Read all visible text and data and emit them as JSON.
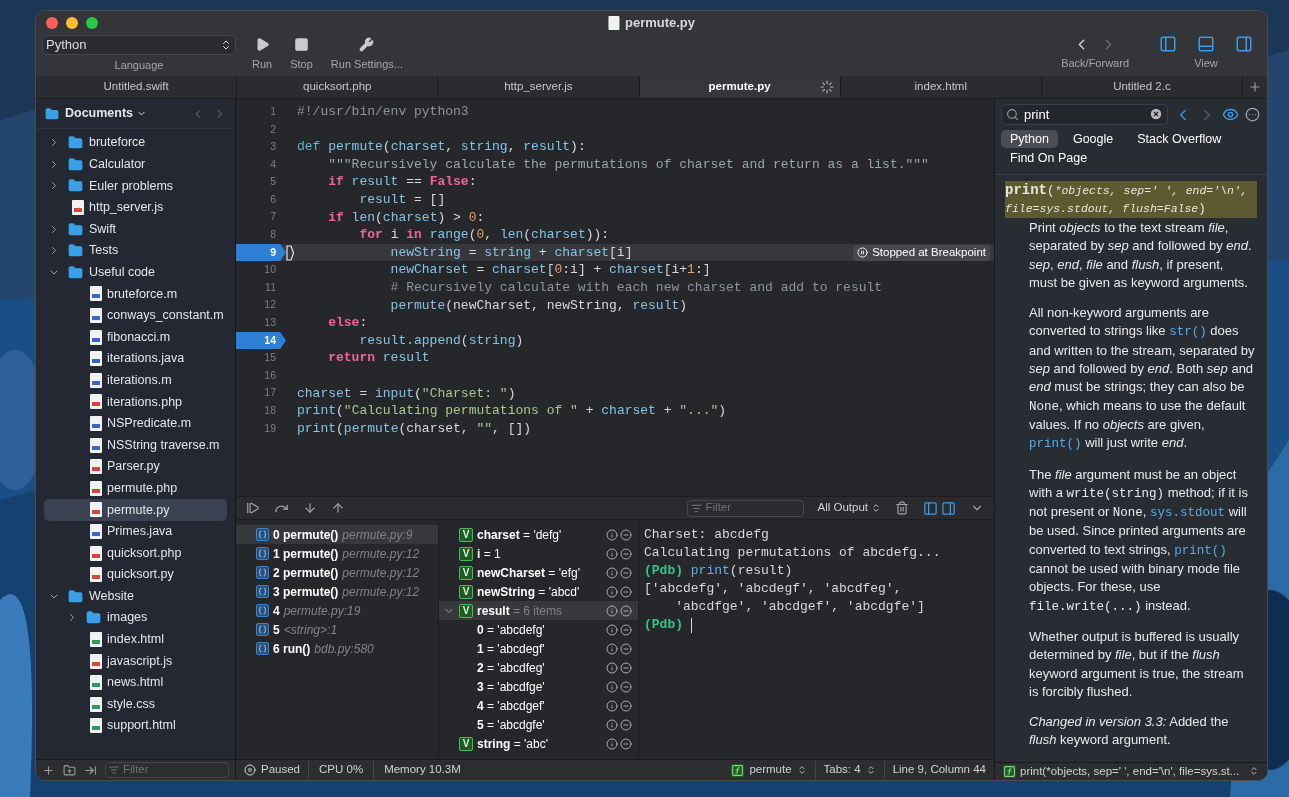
{
  "window": {
    "title": "permute.py"
  },
  "toolbar": {
    "language": {
      "value": "Python",
      "label": "Language"
    },
    "actions": [
      {
        "label": "Run",
        "kind": "run"
      },
      {
        "label": "Stop",
        "kind": "stop"
      },
      {
        "label": "Run Settings...",
        "kind": "settings"
      }
    ],
    "navigation": {
      "label": "Back/Forward",
      "back_enabled": true,
      "forward_enabled": false
    },
    "view": {
      "label": "View",
      "panels": [
        {
          "kind": "left",
          "on": true
        },
        {
          "kind": "bottom",
          "on": true
        },
        {
          "kind": "right",
          "on": true
        }
      ]
    }
  },
  "tabs": [
    {
      "label": "Untitled.swift",
      "selected": false,
      "busy": false
    },
    {
      "label": "quicksort.php",
      "selected": false,
      "busy": false
    },
    {
      "label": "http_server.js",
      "selected": false,
      "busy": false
    },
    {
      "label": "permute.py",
      "selected": true,
      "busy": true
    },
    {
      "label": "index.html",
      "selected": false,
      "busy": false
    },
    {
      "label": "Untitled 2.c",
      "selected": false,
      "busy": false
    }
  ],
  "sidebar": {
    "title": "Documents",
    "filter": {
      "placeholder": "Filter"
    },
    "items": [
      {
        "name": "bruteforce",
        "kind": "folder",
        "expanded": false,
        "selected": false
      },
      {
        "name": "Calculator",
        "kind": "folder",
        "expanded": false,
        "selected": false
      },
      {
        "name": "Euler problems",
        "kind": "folder",
        "expanded": false,
        "selected": false
      },
      {
        "name": "http_server.js",
        "kind": "file",
        "color": "#d9443f",
        "selected": false
      },
      {
        "name": "Swift",
        "kind": "folder",
        "expanded": false,
        "selected": false
      },
      {
        "name": "Tests",
        "kind": "folder",
        "expanded": false,
        "selected": false
      },
      {
        "name": "Useful code",
        "kind": "folder",
        "expanded": true,
        "selected": false,
        "children": [
          {
            "name": "bruteforce.m",
            "kind": "file",
            "color": "#3a64c8",
            "selected": false
          },
          {
            "name": "conways_constant.m",
            "kind": "file",
            "color": "#3a64c8",
            "selected": false
          },
          {
            "name": "fibonacci.m",
            "kind": "file",
            "color": "#3a64c8",
            "selected": false
          },
          {
            "name": "iterations.java",
            "kind": "file",
            "color": "#3a64c8",
            "selected": false
          },
          {
            "name": "iterations.m",
            "kind": "file",
            "color": "#3a64c8",
            "selected": false
          },
          {
            "name": "iterations.php",
            "kind": "file",
            "color": "#d9443f",
            "selected": false
          },
          {
            "name": "NSPredicate.m",
            "kind": "file",
            "color": "#3a64c8",
            "selected": false
          },
          {
            "name": "NSString traverse.m",
            "kind": "file",
            "color": "#3a64c8",
            "selected": false
          },
          {
            "name": "Parser.py",
            "kind": "file",
            "color": "#d9443f",
            "selected": false
          },
          {
            "name": "permute.php",
            "kind": "file",
            "color": "#d9443f",
            "selected": false
          },
          {
            "name": "permute.py",
            "kind": "file",
            "color": "#d9443f",
            "selected": true
          },
          {
            "name": "Primes.java",
            "kind": "file",
            "color": "#3a64c8",
            "selected": false
          },
          {
            "name": "quicksort.php",
            "kind": "file",
            "color": "#d9443f",
            "selected": false
          },
          {
            "name": "quicksort.py",
            "kind": "file",
            "color": "#d9443f",
            "selected": false
          }
        ]
      },
      {
        "name": "Website",
        "kind": "folder",
        "expanded": true,
        "selected": false,
        "children": [
          {
            "name": "images",
            "kind": "folder",
            "expanded": false,
            "selected": false
          },
          {
            "name": "index.html",
            "kind": "file",
            "color": "#2e9a5a",
            "selected": false
          },
          {
            "name": "javascript.js",
            "kind": "file",
            "color": "#d9443f",
            "selected": false
          },
          {
            "name": "news.html",
            "kind": "file",
            "color": "#2e9a5a",
            "selected": false
          },
          {
            "name": "style.css",
            "kind": "file",
            "color": "#2e9a5a",
            "selected": false
          },
          {
            "name": "support.html",
            "kind": "file",
            "color": "#2e9a5a",
            "selected": false
          }
        ]
      }
    ]
  },
  "editor": {
    "lines": [
      {
        "number": "1",
        "breakpoint": false,
        "current": false,
        "tokens": [
          {
            "text": "#!/usr/bin/env python3",
            "kind": "comment"
          }
        ]
      },
      {
        "number": "2",
        "breakpoint": false,
        "current": false
      },
      {
        "number": "3",
        "breakpoint": false,
        "current": false,
        "tokens": [
          {
            "text": "def",
            "kind": "def"
          },
          {
            "text": " permute",
            "kind": "name"
          },
          {
            "text": "(",
            "kind": "plain"
          },
          {
            "text": "charset",
            "kind": "name"
          },
          {
            "text": ", ",
            "kind": "plain"
          },
          {
            "text": "string",
            "kind": "name"
          },
          {
            "text": ", ",
            "kind": "plain"
          },
          {
            "text": "result",
            "kind": "name"
          },
          {
            "text": "):",
            "kind": "plain"
          }
        ]
      },
      {
        "number": "4",
        "breakpoint": false,
        "current": false,
        "tokens": [
          {
            "text": "    \"\"\"Recursively calculate the permutations of charset and return as a list.\"\"\"",
            "kind": "doc"
          }
        ]
      },
      {
        "number": "5",
        "breakpoint": false,
        "current": false,
        "tokens": [
          {
            "text": "    if",
            "kind": "kw"
          },
          {
            "text": " result",
            "kind": "name"
          },
          {
            "text": " == ",
            "kind": "plain"
          },
          {
            "text": "False",
            "kind": "kw"
          },
          {
            "text": ":",
            "kind": "plain"
          }
        ]
      },
      {
        "number": "6",
        "breakpoint": false,
        "current": false,
        "tokens": [
          {
            "text": "        result",
            "kind": "name"
          },
          {
            "text": " = []",
            "kind": "plain"
          }
        ]
      },
      {
        "number": "7",
        "breakpoint": false,
        "current": false,
        "tokens": [
          {
            "text": "    if",
            "kind": "kw"
          },
          {
            "text": " len",
            "kind": "name"
          },
          {
            "text": "(",
            "kind": "plain"
          },
          {
            "text": "charset",
            "kind": "name"
          },
          {
            "text": ") > ",
            "kind": "plain"
          },
          {
            "text": "0",
            "kind": "num"
          },
          {
            "text": ":",
            "kind": "plain"
          }
        ]
      },
      {
        "number": "8",
        "breakpoint": false,
        "current": false,
        "tokens": [
          {
            "text": "        for",
            "kind": "kw"
          },
          {
            "text": " i ",
            "kind": "plain"
          },
          {
            "text": "in",
            "kind": "kw"
          },
          {
            "text": " range",
            "kind": "name"
          },
          {
            "text": "(",
            "kind": "plain"
          },
          {
            "text": "0",
            "kind": "num"
          },
          {
            "text": ", ",
            "kind": "plain"
          },
          {
            "text": "len",
            "kind": "name"
          },
          {
            "text": "(",
            "kind": "plain"
          },
          {
            "text": "charset",
            "kind": "name"
          },
          {
            "text": ")):",
            "kind": "plain"
          }
        ]
      },
      {
        "number": "9",
        "breakpoint": true,
        "current": true,
        "badge": "Stopped at Breakpoint",
        "tokens": [
          {
            "text": "            newString",
            "kind": "name"
          },
          {
            "text": " = ",
            "kind": "plain"
          },
          {
            "text": "string",
            "kind": "name"
          },
          {
            "text": " + ",
            "kind": "plain"
          },
          {
            "text": "charset",
            "kind": "name"
          },
          {
            "text": "[i]",
            "kind": "plain"
          }
        ]
      },
      {
        "number": "10",
        "breakpoint": false,
        "current": false,
        "tokens": [
          {
            "text": "            newCharset",
            "kind": "name"
          },
          {
            "text": " = ",
            "kind": "plain"
          },
          {
            "text": "charset",
            "kind": "name"
          },
          {
            "text": "[",
            "kind": "plain"
          },
          {
            "text": "0",
            "kind": "num"
          },
          {
            "text": ":i] + ",
            "kind": "plain"
          },
          {
            "text": "charset",
            "kind": "name"
          },
          {
            "text": "[i+",
            "kind": "plain"
          },
          {
            "text": "1",
            "kind": "num"
          },
          {
            "text": ":]",
            "kind": "plain"
          }
        ]
      },
      {
        "number": "11",
        "breakpoint": false,
        "current": false,
        "tokens": [
          {
            "text": "            # Recursively calculate with each new charset and add to result",
            "kind": "comment"
          }
        ]
      },
      {
        "number": "12",
        "breakpoint": false,
        "current": false,
        "tokens": [
          {
            "text": "            permute",
            "kind": "name"
          },
          {
            "text": "(newCharset, newString, ",
            "kind": "plain"
          },
          {
            "text": "result",
            "kind": "name"
          },
          {
            "text": ")",
            "kind": "plain"
          }
        ]
      },
      {
        "number": "13",
        "breakpoint": false,
        "current": false,
        "tokens": [
          {
            "text": "    else",
            "kind": "kw"
          },
          {
            "text": ":",
            "kind": "plain"
          }
        ]
      },
      {
        "number": "14",
        "breakpoint": true,
        "current": false,
        "tokens": [
          {
            "text": "        result.append",
            "kind": "name"
          },
          {
            "text": "(",
            "kind": "plain"
          },
          {
            "text": "string",
            "kind": "name"
          },
          {
            "text": ")",
            "kind": "plain"
          }
        ]
      },
      {
        "number": "15",
        "breakpoint": false,
        "current": false,
        "tokens": [
          {
            "text": "    return",
            "kind": "kw"
          },
          {
            "text": " result",
            "kind": "name"
          }
        ]
      },
      {
        "number": "16",
        "breakpoint": false,
        "current": false
      },
      {
        "number": "17",
        "breakpoint": false,
        "current": false,
        "tokens": [
          {
            "text": "charset",
            "kind": "name"
          },
          {
            "text": " = ",
            "kind": "plain"
          },
          {
            "text": "input",
            "kind": "name"
          },
          {
            "text": "(",
            "kind": "plain"
          },
          {
            "text": "\"Charset: \"",
            "kind": "str"
          },
          {
            "text": ")",
            "kind": "plain"
          }
        ]
      },
      {
        "number": "18",
        "breakpoint": false,
        "current": false,
        "tokens": [
          {
            "text": "print",
            "kind": "name"
          },
          {
            "text": "(",
            "kind": "plain"
          },
          {
            "text": "\"Calculating permutations of \"",
            "kind": "str"
          },
          {
            "text": " + ",
            "kind": "plain"
          },
          {
            "text": "charset",
            "kind": "name"
          },
          {
            "text": " + ",
            "kind": "plain"
          },
          {
            "text": "\"...\"",
            "kind": "str"
          },
          {
            "text": ")",
            "kind": "plain"
          }
        ]
      },
      {
        "number": "19",
        "breakpoint": false,
        "current": false,
        "tokens": [
          {
            "text": "print",
            "kind": "name"
          },
          {
            "text": "(",
            "kind": "plain"
          },
          {
            "text": "permute",
            "kind": "name"
          },
          {
            "text": "(charset, ",
            "kind": "plain"
          },
          {
            "text": "\"\"",
            "kind": "str"
          },
          {
            "text": ", [])",
            "kind": "plain"
          }
        ]
      }
    ]
  },
  "debugger": {
    "filter": {
      "placeholder": "Filter"
    },
    "output_mode": "All Output",
    "panels": [
      {
        "on": true
      },
      {
        "on": true
      }
    ],
    "frames": [
      {
        "index": "0",
        "function": "permute()",
        "location": "permute.py:9",
        "selected": true
      },
      {
        "index": "1",
        "function": "permute()",
        "location": "permute.py:12",
        "selected": false
      },
      {
        "index": "2",
        "function": "permute()",
        "location": "permute.py:12",
        "selected": false
      },
      {
        "index": "3",
        "function": "permute()",
        "location": "permute.py:12",
        "selected": false
      },
      {
        "index": "4",
        "location": "permute.py:19",
        "selected": false
      },
      {
        "index": "5",
        "location": "<string>:1",
        "selected": false
      },
      {
        "index": "6",
        "function": "run()",
        "location": "bdb.py:580",
        "selected": false
      }
    ],
    "variables": [
      {
        "badge": "V",
        "name": "charset",
        "value": " = 'defg'",
        "selected": false
      },
      {
        "badge": "V",
        "name": "i",
        "value": " = 1",
        "selected": false
      },
      {
        "badge": "V",
        "name": "newCharset",
        "value": " = 'efg'",
        "selected": false
      },
      {
        "badge": "V",
        "name": "newString",
        "value": " = 'abcd'",
        "selected": false
      },
      {
        "badge": "V",
        "name": "result",
        "summary": " = 6 items",
        "selected": true,
        "expanded": true,
        "children": [
          {
            "name": "0",
            "value": " = 'abcdefg'",
            "selected": false
          },
          {
            "name": "1",
            "value": " = 'abcdegf'",
            "selected": false
          },
          {
            "name": "2",
            "value": " = 'abcdfeg'",
            "selected": false
          },
          {
            "name": "3",
            "value": " = 'abcdfge'",
            "selected": false
          },
          {
            "name": "4",
            "value": " = 'abcdgef'",
            "selected": false
          },
          {
            "name": "5",
            "value": " = 'abcdgfe'",
            "selected": false
          }
        ]
      },
      {
        "badge": "V",
        "name": "string",
        "value": " = 'abc'",
        "selected": false
      }
    ],
    "console": [
      {
        "kind": "output",
        "text": "Charset: abcdefg"
      },
      {
        "kind": "output",
        "text": "Calculating permutations of abcdefg..."
      },
      {
        "kind": "prompt",
        "prompt": "(Pdb)",
        "call": "print",
        "rest": "(result)",
        "cursor": false
      },
      {
        "kind": "output",
        "text": "['abcdefg', 'abcdegf', 'abcdfeg',"
      },
      {
        "kind": "output",
        "text": "    'abcdfge', 'abcdgef', 'abcdgfe']"
      },
      {
        "kind": "prompt",
        "prompt": "(Pdb)",
        "cursor": true
      }
    ]
  },
  "status_bar": {
    "state": "Paused",
    "cpu": "CPU 0%",
    "memory": "Memory 10.3M",
    "function": "permute",
    "tabs": "Tabs: 4",
    "position": "Line 9, Column 44"
  },
  "docs": {
    "search": {
      "value": "print"
    },
    "back_enabled": true,
    "forward_enabled": false,
    "scopes": [
      {
        "label": "Python",
        "selected": true
      },
      {
        "label": "Google",
        "selected": false
      },
      {
        "label": "Stack Overflow",
        "selected": false
      },
      {
        "label": "Find On Page",
        "selected": false
      }
    ],
    "signature": {
      "name": "print",
      "open": "(",
      "args": "*objects, sep=' ', end='\\n', file=sys.stdout, flush=False",
      "close": ")"
    },
    "paragraphs": [
      [
        {
          "text": "Print ",
          "kind": "plain"
        },
        {
          "text": "objects",
          "kind": "em"
        },
        {
          "text": " to the text stream ",
          "kind": "plain"
        },
        {
          "text": "file",
          "kind": "em"
        },
        {
          "text": ", separated by ",
          "kind": "plain"
        },
        {
          "text": "sep",
          "kind": "em"
        },
        {
          "text": " and followed by ",
          "kind": "plain"
        },
        {
          "text": "end",
          "kind": "em"
        },
        {
          "text": ". ",
          "kind": "plain"
        },
        {
          "text": "sep",
          "kind": "em"
        },
        {
          "text": ", ",
          "kind": "plain"
        },
        {
          "text": "end",
          "kind": "em"
        },
        {
          "text": ", ",
          "kind": "plain"
        },
        {
          "text": "file",
          "kind": "em"
        },
        {
          "text": " and ",
          "kind": "plain"
        },
        {
          "text": "flush",
          "kind": "em"
        },
        {
          "text": ", if present, must be given as keyword arguments.",
          "kind": "plain"
        }
      ],
      [
        {
          "text": "All non-keyword arguments are converted to strings like ",
          "kind": "plain"
        },
        {
          "text": "str()",
          "kind": "link"
        },
        {
          "text": " does and written to the stream, separated by ",
          "kind": "plain"
        },
        {
          "text": "sep",
          "kind": "em"
        },
        {
          "text": " and followed by ",
          "kind": "plain"
        },
        {
          "text": "end",
          "kind": "em"
        },
        {
          "text": ". Both ",
          "kind": "plain"
        },
        {
          "text": "sep",
          "kind": "em"
        },
        {
          "text": " and ",
          "kind": "plain"
        },
        {
          "text": "end",
          "kind": "em"
        },
        {
          "text": " must be strings; they can also be ",
          "kind": "plain"
        },
        {
          "text": "None",
          "kind": "code"
        },
        {
          "text": ", which means to use the default values. If no ",
          "kind": "plain"
        },
        {
          "text": "objects",
          "kind": "em"
        },
        {
          "text": " are given, ",
          "kind": "plain"
        },
        {
          "text": "print()",
          "kind": "link"
        },
        {
          "text": " will just write ",
          "kind": "plain"
        },
        {
          "text": "end",
          "kind": "em"
        },
        {
          "text": ".",
          "kind": "plain"
        }
      ],
      [
        {
          "text": "The ",
          "kind": "plain"
        },
        {
          "text": "file",
          "kind": "em"
        },
        {
          "text": " argument must be an object with a ",
          "kind": "plain"
        },
        {
          "text": "write(string)",
          "kind": "code"
        },
        {
          "text": " method; if it is not present or ",
          "kind": "plain"
        },
        {
          "text": "None",
          "kind": "code"
        },
        {
          "text": ", ",
          "kind": "plain"
        },
        {
          "text": "sys.stdout",
          "kind": "link"
        },
        {
          "text": " will be used. Since printed arguments are converted to text strings, ",
          "kind": "plain"
        },
        {
          "text": "print()",
          "kind": "link"
        },
        {
          "text": " cannot be used with binary mode file objects. For these, use ",
          "kind": "plain"
        },
        {
          "text": "file.write(...)",
          "kind": "code"
        },
        {
          "text": " instead.",
          "kind": "plain"
        }
      ],
      [
        {
          "text": "Whether output is buffered is usually determined by ",
          "kind": "plain"
        },
        {
          "text": "file",
          "kind": "em"
        },
        {
          "text": ", but if the ",
          "kind": "plain"
        },
        {
          "text": "flush",
          "kind": "em"
        },
        {
          "text": " keyword argument is true, the stream is forcibly flushed.",
          "kind": "plain"
        }
      ],
      [
        {
          "text": "Changed in version 3.3:",
          "kind": "em"
        },
        {
          "text": " Added the ",
          "kind": "plain"
        },
        {
          "text": "flush",
          "kind": "em"
        },
        {
          "text": " keyword argument.",
          "kind": "plain"
        }
      ]
    ],
    "status": "print(*objects, sep=' ', end='\\n', file=sys.st..."
  }
}
